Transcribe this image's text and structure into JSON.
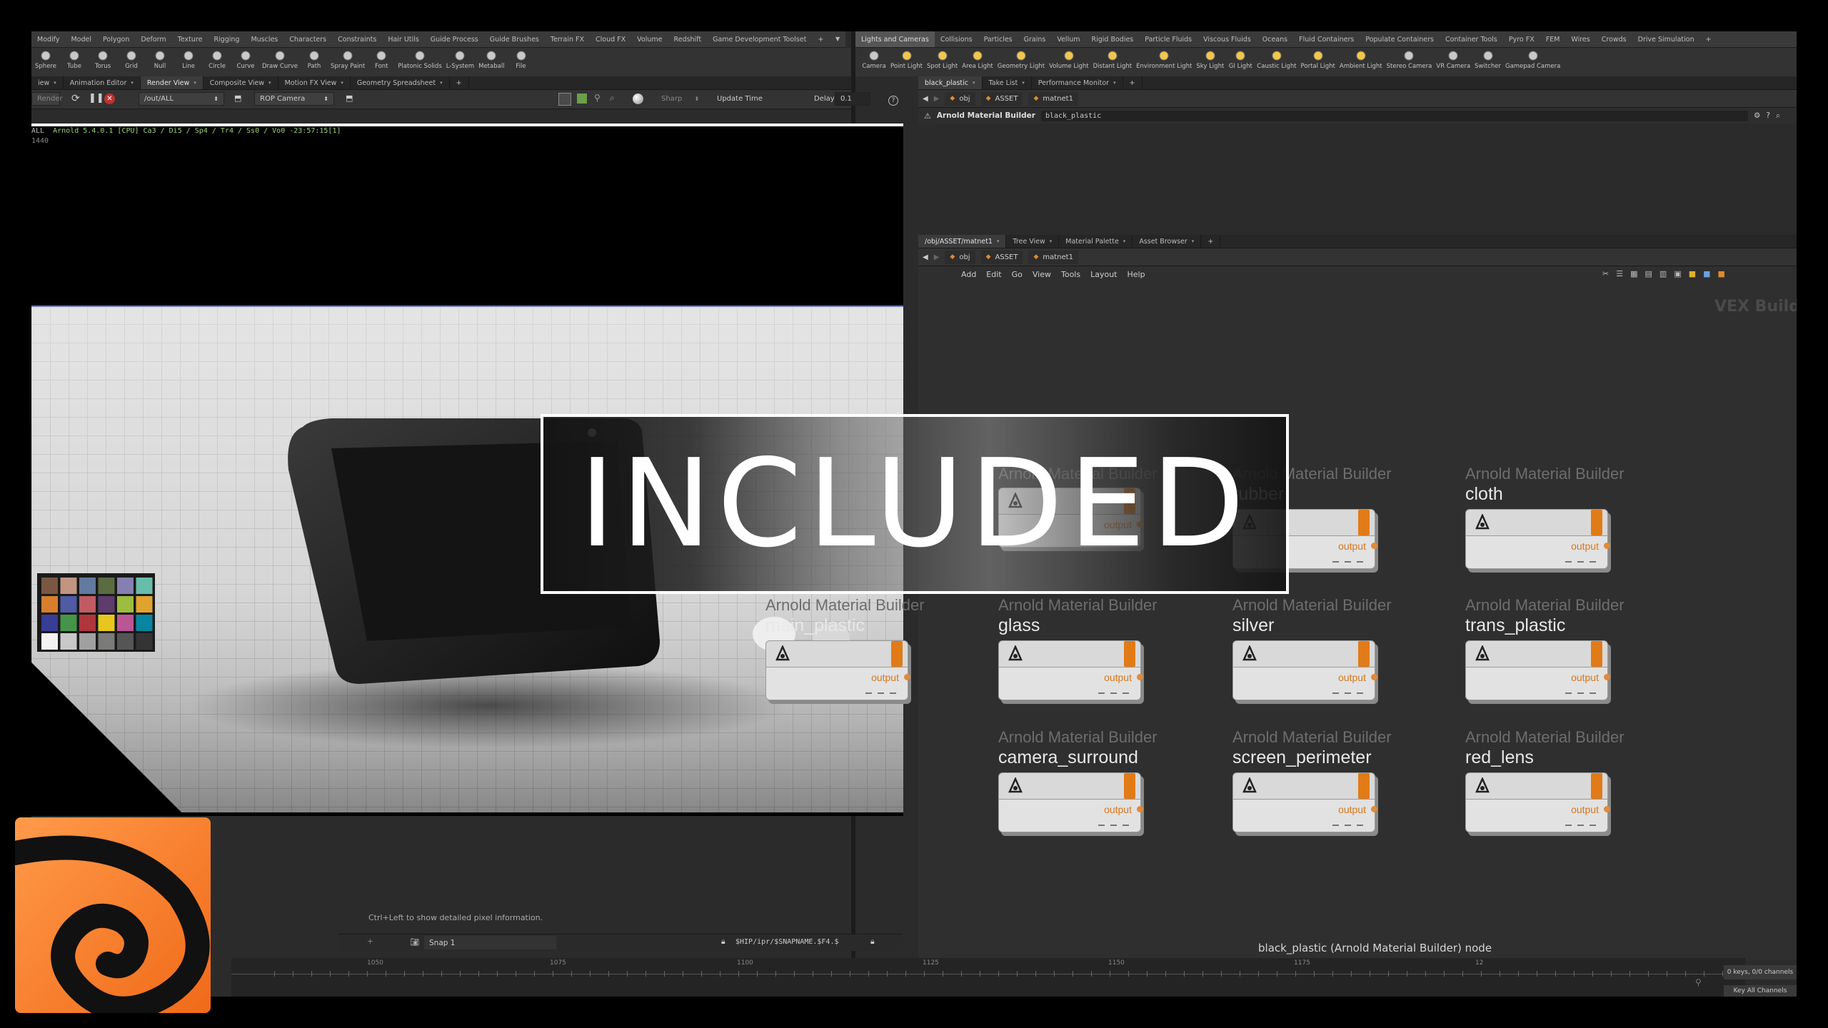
{
  "left_shelf_tabs": [
    "Modify",
    "Model",
    "Polygon",
    "Deform",
    "Texture",
    "Rigging",
    "Muscles",
    "Characters",
    "Constraints",
    "Hair Utils",
    "Guide Process",
    "Guide Brushes",
    "Terrain FX",
    "Cloud FX",
    "Volume",
    "Redshift",
    "Game Development Toolset",
    "+"
  ],
  "left_tools": [
    {
      "label": "Sphere",
      "icon": "sphere-icon"
    },
    {
      "label": "Tube",
      "icon": "tube-icon"
    },
    {
      "label": "Torus",
      "icon": "torus-icon"
    },
    {
      "label": "Grid",
      "icon": "grid-icon"
    },
    {
      "label": "Null",
      "icon": "null-icon"
    },
    {
      "label": "Line",
      "icon": "line-icon"
    },
    {
      "label": "Circle",
      "icon": "circle-icon"
    },
    {
      "label": "Curve",
      "icon": "curve-icon"
    },
    {
      "label": "Draw Curve",
      "icon": "draw-curve-icon"
    },
    {
      "label": "Path",
      "icon": "path-icon"
    },
    {
      "label": "Spray Paint",
      "icon": "spray-paint-icon"
    },
    {
      "label": "Font",
      "icon": "font-icon"
    },
    {
      "label": "Platonic Solids",
      "icon": "platonic-icon"
    },
    {
      "label": "L-System",
      "icon": "lsystem-icon"
    },
    {
      "label": "Metaball",
      "icon": "metaball-icon"
    },
    {
      "label": "File",
      "icon": "file-icon"
    }
  ],
  "right_shelf_tabs": [
    "Lights and Cameras",
    "Collisions",
    "Particles",
    "Grains",
    "Vellum",
    "Rigid Bodies",
    "Particle Fluids",
    "Viscous Fluids",
    "Oceans",
    "Fluid Containers",
    "Populate Containers",
    "Container Tools",
    "Pyro FX",
    "FEM",
    "Wires",
    "Crowds",
    "Drive Simulation",
    "+"
  ],
  "right_tools": [
    {
      "label": "Camera",
      "icon": "camera-icon"
    },
    {
      "label": "Point Light",
      "icon": "point-light-icon"
    },
    {
      "label": "Spot Light",
      "icon": "spot-light-icon"
    },
    {
      "label": "Area Light",
      "icon": "area-light-icon"
    },
    {
      "label": "Geometry Light",
      "icon": "geometry-light-icon"
    },
    {
      "label": "Volume Light",
      "icon": "volume-light-icon"
    },
    {
      "label": "Distant Light",
      "icon": "distant-light-icon"
    },
    {
      "label": "Environment Light",
      "icon": "environment-light-icon"
    },
    {
      "label": "Sky Light",
      "icon": "sky-light-icon"
    },
    {
      "label": "GI Light",
      "icon": "gi-light-icon"
    },
    {
      "label": "Caustic Light",
      "icon": "caustic-light-icon"
    },
    {
      "label": "Portal Light",
      "icon": "portal-light-icon"
    },
    {
      "label": "Ambient Light",
      "icon": "ambient-light-icon"
    },
    {
      "label": "Stereo Camera",
      "icon": "stereo-camera-icon"
    },
    {
      "label": "VR Camera",
      "icon": "vr-camera-icon"
    },
    {
      "label": "Switcher",
      "icon": "switcher-icon"
    },
    {
      "label": "Gamepad Camera",
      "icon": "gamepad-camera-icon"
    }
  ],
  "left_pane_tabs": [
    "iew",
    "Animation Editor",
    "Render View",
    "Composite View",
    "Motion FX View",
    "Geometry Spreadsheet",
    "+"
  ],
  "render_toolbar": {
    "render_label": "Render",
    "rop_path": "/out/ALL",
    "camera": "ROP Camera",
    "sharp_label": "Sharp",
    "update_label": "Update Time",
    "delay_label": "Delay",
    "delay_value": "0.1"
  },
  "render_overlay": {
    "line1_prefix": "ALL",
    "line1": "Arnold 5.4.0.1 [CPU] Ca3 / Di5 / Sp4 / Tr4 / Ss0 / Vo0 -23:57:15[1]",
    "line2": "1440"
  },
  "render_hint": "Ctrl+Left to show detailed pixel information.",
  "snap_bar": {
    "snap_label": "Snap 1",
    "snap_path": "$HIP/ipr/$SNAPNAME.$F4.$"
  },
  "param_pane": {
    "tabs": [
      "black_plastic",
      "Take List",
      "Performance Monitor",
      "+"
    ],
    "path": [
      "obj",
      "ASSET",
      "matnet1"
    ],
    "node_type": "Arnold Material Builder",
    "node_name": "black_plastic"
  },
  "network_pane": {
    "tabs": [
      "/obj/ASSET/matnet1",
      "Tree View",
      "Material Palette",
      "Asset Browser",
      "+"
    ],
    "path": [
      "obj",
      "ASSET",
      "matnet1"
    ],
    "menu": [
      "Add",
      "Edit",
      "Go",
      "View",
      "Tools",
      "Layout",
      "Help"
    ],
    "context_label": "VEX Builder",
    "status": "black_plastic (Arnold Material Builder) node"
  },
  "nodes": [
    {
      "type": "Arnold Material Builder",
      "name": "",
      "output": "output"
    },
    {
      "type": "Arnold Material Builder",
      "name": "rubber",
      "output": "output"
    },
    {
      "type": "Arnold Material Builder",
      "name": "cloth",
      "output": "output"
    },
    {
      "type": "Arnold Material Builder",
      "name": "main_plastic",
      "output": "output"
    },
    {
      "type": "Arnold Material Builder",
      "name": "glass",
      "output": "output"
    },
    {
      "type": "Arnold Material Builder",
      "name": "silver",
      "output": "output"
    },
    {
      "type": "Arnold Material Builder",
      "name": "trans_plastic",
      "output": "output"
    },
    {
      "type": "Arnold Material Builder",
      "name": "camera_surround",
      "output": "output"
    },
    {
      "type": "Arnold Material Builder",
      "name": "screen_perimeter",
      "output": "output"
    },
    {
      "type": "Arnold Material Builder",
      "name": "red_lens",
      "output": "output"
    }
  ],
  "timeline": {
    "ticks": [
      "1050",
      "1075",
      "1100",
      "1125",
      "1150",
      "1175",
      "12"
    ],
    "keys_label": "0 keys, 0/0 channels",
    "key_all_label": "Key All Channels"
  },
  "banner": "INCLUDED",
  "colors": {
    "accent_orange": "#e07b18",
    "banner_border": "#ffffff",
    "logo_orange": "#f47b20"
  }
}
